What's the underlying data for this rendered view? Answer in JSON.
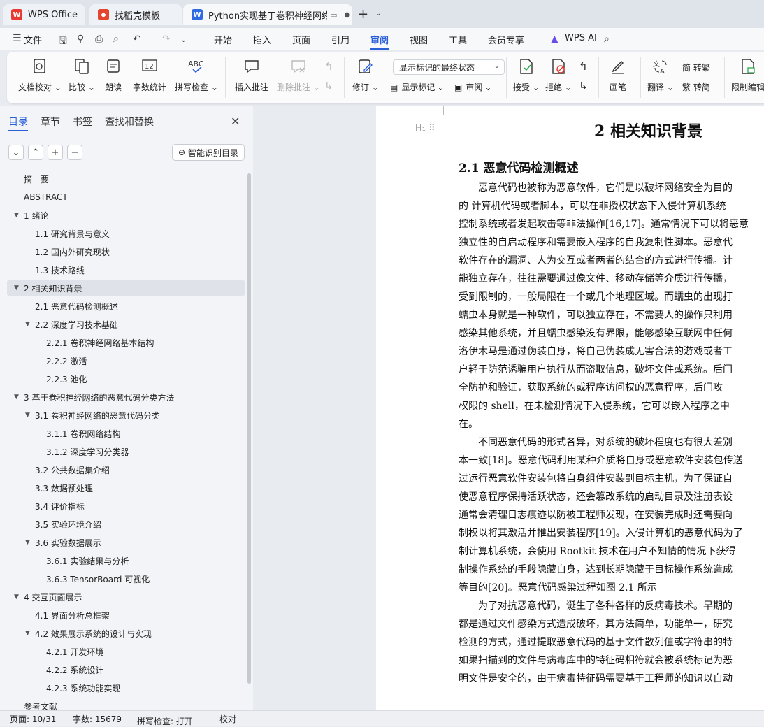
{
  "tabs": [
    {
      "label": "WPS Office",
      "icon": "wps-logo"
    },
    {
      "label": "找稻壳模板",
      "icon": "docer-logo"
    },
    {
      "label": "Python实现基于卷积神经网络的恶意代码分类",
      "icon": "writer-logo"
    }
  ],
  "menu": {
    "file": "文件",
    "items": [
      "开始",
      "插入",
      "页面",
      "引用",
      "审阅",
      "视图",
      "工具",
      "会员专享"
    ],
    "active": "审阅",
    "wps_ai": "WPS AI"
  },
  "ribbon": {
    "doc_check": "文档校对",
    "compare": "比较",
    "read_aloud": "朗读",
    "word_count": "字数统计",
    "spell_check": "拼写检查",
    "insert_comment": "插入批注",
    "delete_comment": "删除批注",
    "revise": "修订",
    "markup_dropdown": "显示标记的最终状态",
    "show_markup": "显示标记",
    "review": "审阅",
    "accept": "接受",
    "reject": "拒绝",
    "pen": "画笔",
    "translate": "翻译",
    "to_traditional": "简 转繁",
    "to_simplified": "繁 转简",
    "restrict_editing": "限制编辑"
  },
  "sidebar": {
    "tabs": [
      "目录",
      "章节",
      "书签",
      "查找和替换"
    ],
    "smart_toc": "智能识别目录",
    "toc": [
      {
        "label": "摘　要",
        "level": 0,
        "arrow": ""
      },
      {
        "label": "ABSTRACT",
        "level": 0,
        "arrow": ""
      },
      {
        "label": "1  绪论",
        "level": 0,
        "arrow": "▼"
      },
      {
        "label": "1.1  研究背景与意义",
        "level": 1,
        "arrow": ""
      },
      {
        "label": "1.2  国内外研究现状",
        "level": 1,
        "arrow": ""
      },
      {
        "label": "1.3  技术路线",
        "level": 1,
        "arrow": ""
      },
      {
        "label": "2  相关知识背景",
        "level": 0,
        "arrow": "▼",
        "selected": true
      },
      {
        "label": "2.1  恶意代码检测概述",
        "level": 1,
        "arrow": ""
      },
      {
        "label": "2.2  深度学习技术基础",
        "level": 1,
        "arrow": "▼"
      },
      {
        "label": "2.2.1 卷积神经网络基本结构",
        "level": 2,
        "arrow": ""
      },
      {
        "label": "2.2.2 激活",
        "level": 2,
        "arrow": ""
      },
      {
        "label": "2.2.3 池化",
        "level": 2,
        "arrow": ""
      },
      {
        "label": "3  基于卷积神经网络的恶意代码分类方法",
        "level": 0,
        "arrow": "▼"
      },
      {
        "label": "3.1  卷积神经网络的恶意代码分类",
        "level": 1,
        "arrow": "▼"
      },
      {
        "label": "3.1.1  卷积网络结构",
        "level": 2,
        "arrow": ""
      },
      {
        "label": "3.1.2  深度学习分类器",
        "level": 2,
        "arrow": ""
      },
      {
        "label": "3.2 公共数据集介绍",
        "level": 1,
        "arrow": ""
      },
      {
        "label": "3.3 数据预处理",
        "level": 1,
        "arrow": ""
      },
      {
        "label": "3.4  评价指标",
        "level": 1,
        "arrow": ""
      },
      {
        "label": "3.5  实验环境介绍",
        "level": 1,
        "arrow": ""
      },
      {
        "label": "3.6  实验数据展示",
        "level": 1,
        "arrow": "▼"
      },
      {
        "label": "3.6.1  实验结果与分析",
        "level": 2,
        "arrow": ""
      },
      {
        "label": "3.6.3 TensorBoard 可视化",
        "level": 2,
        "arrow": ""
      },
      {
        "label": "4  交互页面展示",
        "level": 0,
        "arrow": "▼"
      },
      {
        "label": "4.1  界面分析总框架",
        "level": 1,
        "arrow": ""
      },
      {
        "label": "4.2  效果展示系统的设计与实现",
        "level": 1,
        "arrow": "▼"
      },
      {
        "label": "4.2.1  开发环境",
        "level": 2,
        "arrow": ""
      },
      {
        "label": "4.2.2  系统设计",
        "level": 2,
        "arrow": ""
      },
      {
        "label": "4.2.3  系统功能实现",
        "level": 2,
        "arrow": ""
      },
      {
        "label": "参考文献",
        "level": 0,
        "arrow": ""
      }
    ]
  },
  "document": {
    "title": "2  相关知识背景",
    "heading": "2.1  恶意代码检测概述",
    "lines": [
      "　　恶意代码也被称为恶意软件，它们是以破坏网络安全为目的",
      "的 计算机代码或者脚本，可以在非授权状态下入侵计算机系统",
      "控制系统或者发起攻击等非法操作[16,17]。通常情况下可以将恶意",
      "独立性的自启动程序和需要嵌入程序的自我复制性脚本。恶意代",
      "软件存在的漏洞、人为交互或者两者的结合的方式进行传播。计",
      "能独立存在，往往需要通过像文件、移动存储等介质进行传播，",
      "受到限制的，一般局限在一个或几个地理区域。而蠕虫的出现打",
      "蠕虫本身就是一种软件，可以独立存在，不需要人的操作只利用",
      "感染其他系统，并且蠕虫感染没有界限，能够感染互联网中任何",
      "洛伊木马是通过伪装自身，将自己伪装成无害合法的游戏或者工",
      "户轻于防范诱骗用户执行从而盗取信息，破坏文件或系统。后门",
      "全防护和验证，获取系统的或程序访问权的恶意程序，后门攻",
      "权限的 shell，在未检测情况下入侵系统，它可以嵌入程序之中",
      "在。",
      "　　不同恶意代码的形式各异，对系统的破坏程度也有很大差别",
      "本一致[18]。恶意代码利用某种介质将自身或恶意软件安装包传送",
      "过运行恶意软件安装包将自身组件安装到目标主机，为了保证自",
      "使恶意程序保持活跃状态，还会篡改系统的启动目录及注册表设",
      "通常会清理日志痕迹以防被工程师发现，在安装完成时还需要向",
      "制权以将其激活并推出安装程序[19]。入侵计算机的恶意代码为了",
      "制计算机系统，会使用 Rootkit 技术在用户不知情的情况下获得",
      "制操作系统的手段隐藏自身，达到长期隐藏于目标操作系统造成",
      "等目的[20]。恶意代码感染过程如图 2.1 所示",
      "　　为了对抗恶意代码，诞生了各种各样的反病毒技术。早期的",
      "都是通过文件感染方式造成破坏，其方法简单，功能单一，研究",
      "检测的方式，通过提取恶意代码的基于文件散列值或字符串的特",
      "如果扫描到的文件与病毒库中的特征码相符就会被系统标记为恶",
      "明文件是安全的，由于病毒特征码需要基于工程师的知识以自动"
    ]
  },
  "status": {
    "page": "页面: 10/31",
    "words": "字数: 15679",
    "spell": "拼写检查: 打开",
    "proof": "校对"
  },
  "colors": {
    "accent": "#2b5fd9",
    "wps_red": "#e8382f",
    "writer_blue": "#2f6ae5",
    "docer_red": "#e5452f"
  }
}
